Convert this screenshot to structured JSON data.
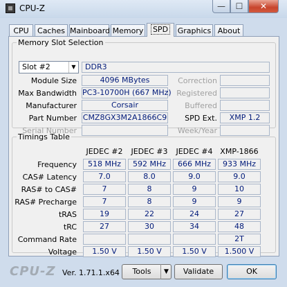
{
  "window": {
    "title": "CPU-Z",
    "minimize_glyph": "—",
    "maximize_glyph": "☐",
    "close_glyph": "✕"
  },
  "tabs": [
    "CPU",
    "Caches",
    "Mainboard",
    "Memory",
    "SPD",
    "Graphics",
    "About"
  ],
  "active_tab": "SPD",
  "memory_slot": {
    "legend": "Memory Slot Selection",
    "slot_selected": "Slot #2",
    "type": "DDR3",
    "module_size_label": "Module Size",
    "module_size": "4096 MBytes",
    "max_bandwidth_label": "Max Bandwidth",
    "max_bandwidth": "PC3-10700H (667 MHz)",
    "manufacturer_label": "Manufacturer",
    "manufacturer": "Corsair",
    "part_number_label": "Part Number",
    "part_number": "CMZ8GX3M2A1866C9",
    "serial_number_label": "Serial Number",
    "serial_number": "",
    "correction_label": "Correction",
    "correction": "",
    "registered_label": "Registered",
    "registered": "",
    "buffered_label": "Buffered",
    "buffered": "",
    "spd_ext_label": "SPD Ext.",
    "spd_ext": "XMP 1.2",
    "week_year_label": "Week/Year",
    "week_year": ""
  },
  "timings": {
    "legend": "Timings Table",
    "columns": [
      "JEDEC #2",
      "JEDEC #3",
      "JEDEC #4",
      "XMP-1866"
    ],
    "rows": [
      {
        "label": "Frequency",
        "values": [
          "518 MHz",
          "592 MHz",
          "666 MHz",
          "933 MHz"
        ]
      },
      {
        "label": "CAS# Latency",
        "values": [
          "7.0",
          "8.0",
          "9.0",
          "9.0"
        ]
      },
      {
        "label": "RAS# to CAS#",
        "values": [
          "7",
          "8",
          "9",
          "10"
        ]
      },
      {
        "label": "RAS# Precharge",
        "values": [
          "7",
          "8",
          "9",
          "9"
        ]
      },
      {
        "label": "tRAS",
        "values": [
          "19",
          "22",
          "24",
          "27"
        ]
      },
      {
        "label": "tRC",
        "values": [
          "27",
          "30",
          "34",
          "48"
        ]
      },
      {
        "label": "Command Rate",
        "values": [
          "",
          "",
          "",
          "2T"
        ]
      },
      {
        "label": "Voltage",
        "values": [
          "1.50 V",
          "1.50 V",
          "1.50 V",
          "1.500 V"
        ]
      }
    ]
  },
  "footer": {
    "logo": "CPU-Z",
    "version": "Ver. 1.71.1.x64",
    "tools_label": "Tools",
    "validate_label": "Validate",
    "ok_label": "OK"
  }
}
